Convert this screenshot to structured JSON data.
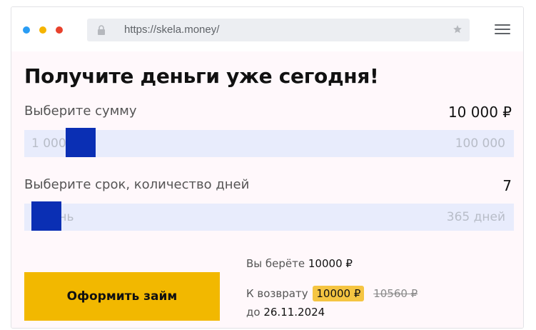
{
  "browser": {
    "url": "https://skela.money/",
    "traffic_light_colors": [
      "#2a9df4",
      "#f5b400",
      "#e8412c"
    ]
  },
  "page": {
    "title": "Получите деньги уже сегодня!"
  },
  "amount": {
    "label": "Выберите сумму",
    "value": "10 000 ₽",
    "min": "1 000",
    "max": "100 000",
    "slider_fraction": 0.09
  },
  "term": {
    "label": "Выберите срок, количество дней",
    "value": "7",
    "min": "1 день",
    "max": "365 дней",
    "slider_fraction": 0.016
  },
  "cta": {
    "label": "Оформить займ",
    "color": "#f2b800"
  },
  "summary": {
    "take_label": "Вы берёте",
    "take_value": "10000 ₽",
    "return_label": "К возврату",
    "return_value": "10000 ₽",
    "return_old_value": "10560 ₽",
    "until_label": "до",
    "until_date": "26.11.2024"
  },
  "colors": {
    "slider_thumb": "#0a2fb4",
    "slider_track": "#e8ecfc",
    "badge": "#f5c542"
  }
}
